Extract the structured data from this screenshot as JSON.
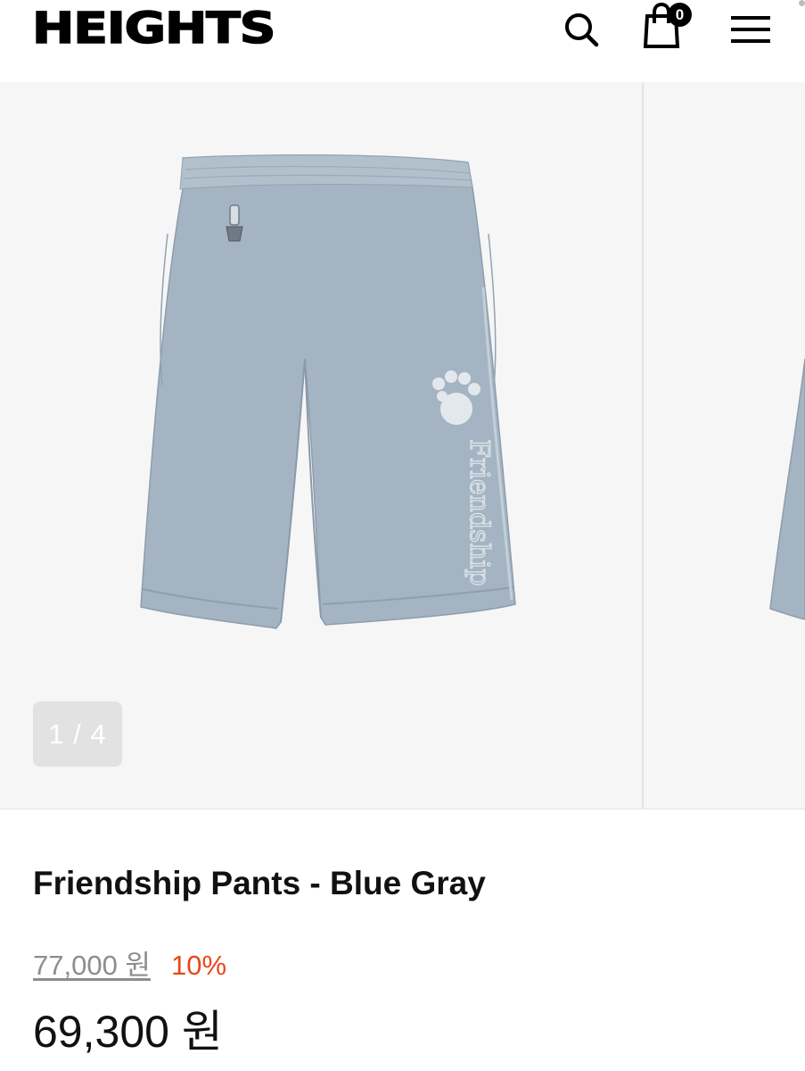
{
  "header": {
    "logo": "HEIGHTS",
    "cart_count": "0"
  },
  "icons": {
    "search": "search-icon",
    "cart": "shopping-bag-icon",
    "menu": "hamburger-menu-icon"
  },
  "gallery": {
    "counter": "1 / 4",
    "current_slide": 1,
    "total_slides": 4,
    "image_alt": "Friendship Pants - Blue Gray",
    "print_text": "Friendship"
  },
  "product": {
    "title": "Friendship Pants - Blue Gray",
    "original_price": "77,000 원",
    "discount": "10%",
    "price": "69,300 원"
  },
  "colors": {
    "discount": "#e8471a",
    "gallery_bg": "#f6f6f6",
    "product_fabric": "#9fb0be"
  }
}
